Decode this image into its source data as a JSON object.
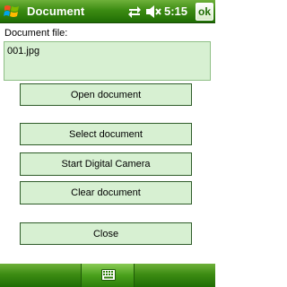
{
  "titlebar": {
    "title": "Document",
    "time": "5:15",
    "ok_label": "ok",
    "start_icon": "windows-flag-icon",
    "network_icon": "network-sync-icon",
    "volume_icon": "speaker-muted-icon"
  },
  "form": {
    "document_label": "Document file:",
    "document_value": "001.jpg"
  },
  "buttons": {
    "open": "Open document",
    "select": "Select document",
    "camera": "Start Digital Camera",
    "clear": "Clear document",
    "close": "Close"
  },
  "softkeys": {
    "keyboard_icon": "keyboard-icon"
  },
  "colors": {
    "bar_green": "#3d8c13",
    "field_bg": "#d7f0d2",
    "button_border": "#2f5c2a"
  }
}
